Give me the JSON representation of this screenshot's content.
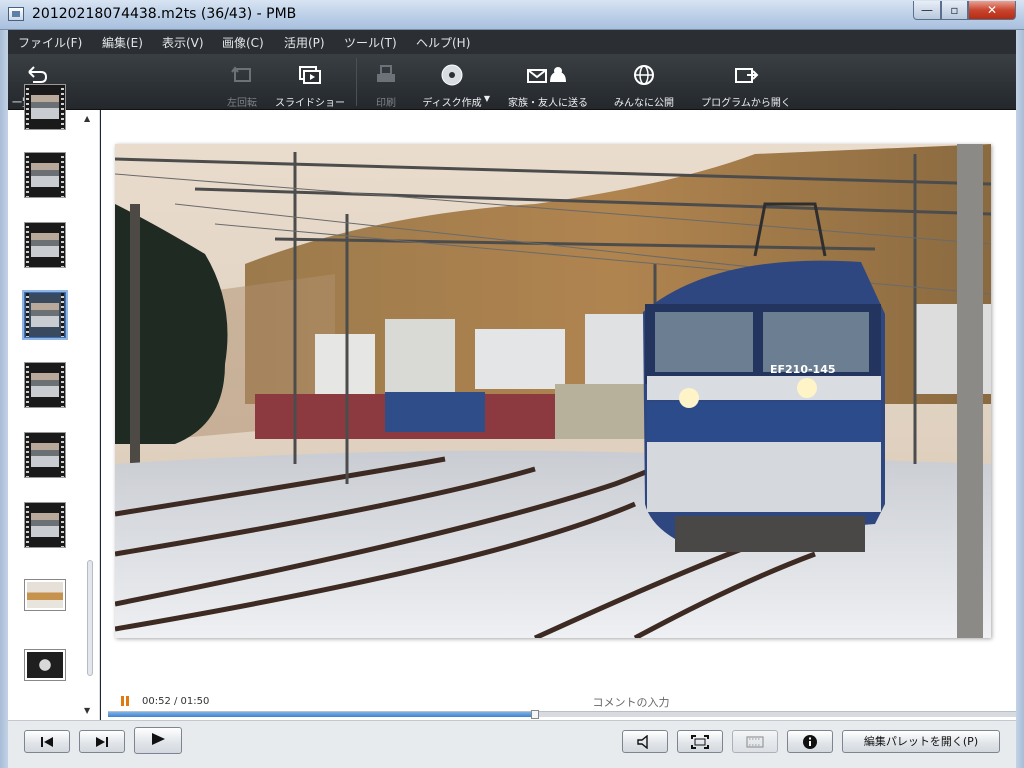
{
  "window": {
    "title": "20120218074438.m2ts (36/43)  - PMB",
    "minimize": "—",
    "maximize": "▫",
    "close": "✕"
  },
  "menu": [
    "ファイル(F)",
    "編集(E)",
    "表示(V)",
    "画像(C)",
    "活用(P)",
    "ツール(T)",
    "ヘルプ(H)"
  ],
  "toolbar": {
    "back": "一覧に戻る",
    "rotate_left": "左回転",
    "slideshow": "スライドショー",
    "print": "印刷",
    "disc": "ディスク作成",
    "send_family": "家族・友人に送る",
    "publish": "みんなに公開",
    "open_with": "プログラムから開く"
  },
  "player": {
    "time": "00:52 / 01:50",
    "progress_fraction": 0.47,
    "comment_placeholder": "コメントの入力",
    "locomotive_number": "EF210-145"
  },
  "bottom": {
    "edit_palette": "編集パレットを開く(P)"
  },
  "colors": {
    "accent_progress": "#3d83cf",
    "toolbar_bg": "#2b2f33",
    "pause": "#e07a10"
  }
}
